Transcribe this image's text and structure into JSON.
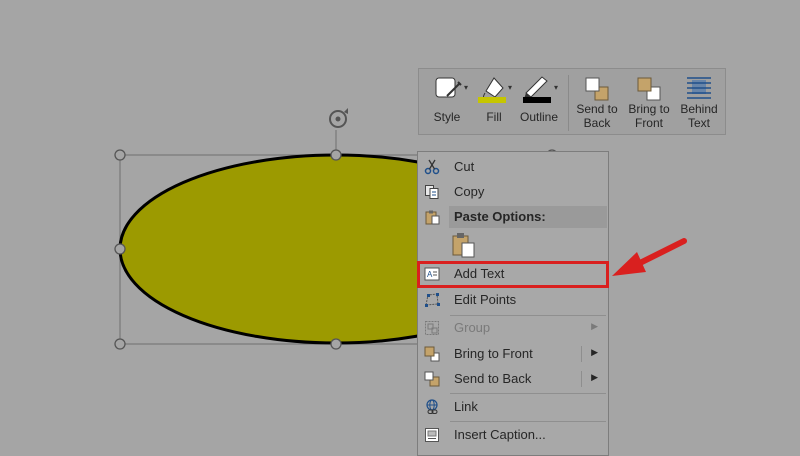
{
  "colors": {
    "background": "#a5a5a5",
    "shape_fill": "#9c9a00",
    "fill_swatch": "#c6c600",
    "outline_swatch": "#000000",
    "highlight": "#d9201f"
  },
  "toolbar": {
    "style": "Style",
    "fill": "Fill",
    "outline": "Outline",
    "send_to_back": [
      "Send to",
      "Back"
    ],
    "bring_to_front": [
      "Bring to",
      "Front"
    ],
    "behind_text": [
      "Behind",
      "Text"
    ]
  },
  "menu": {
    "cut": "Cut",
    "copy": "Copy",
    "paste_options": "Paste Options:",
    "add_text": "Add Text",
    "edit_points": "Edit Points",
    "group": "Group",
    "bring_to_front": "Bring to Front",
    "send_to_back": "Send to Back",
    "link": "Link",
    "insert_caption": "Insert Caption..."
  },
  "icons": {
    "rotate": "rotate-handle-icon",
    "cut": "scissors-icon",
    "copy": "copy-icon",
    "paste": "clipboard-icon",
    "add_text": "text-box-icon",
    "edit_points": "edit-points-icon",
    "group": "group-icon",
    "bring_to_front": "bring-to-front-icon",
    "send_to_back": "send-to-back-icon",
    "link": "link-icon",
    "insert_caption": "caption-icon",
    "annotation_arrow": "red-arrow-icon"
  }
}
